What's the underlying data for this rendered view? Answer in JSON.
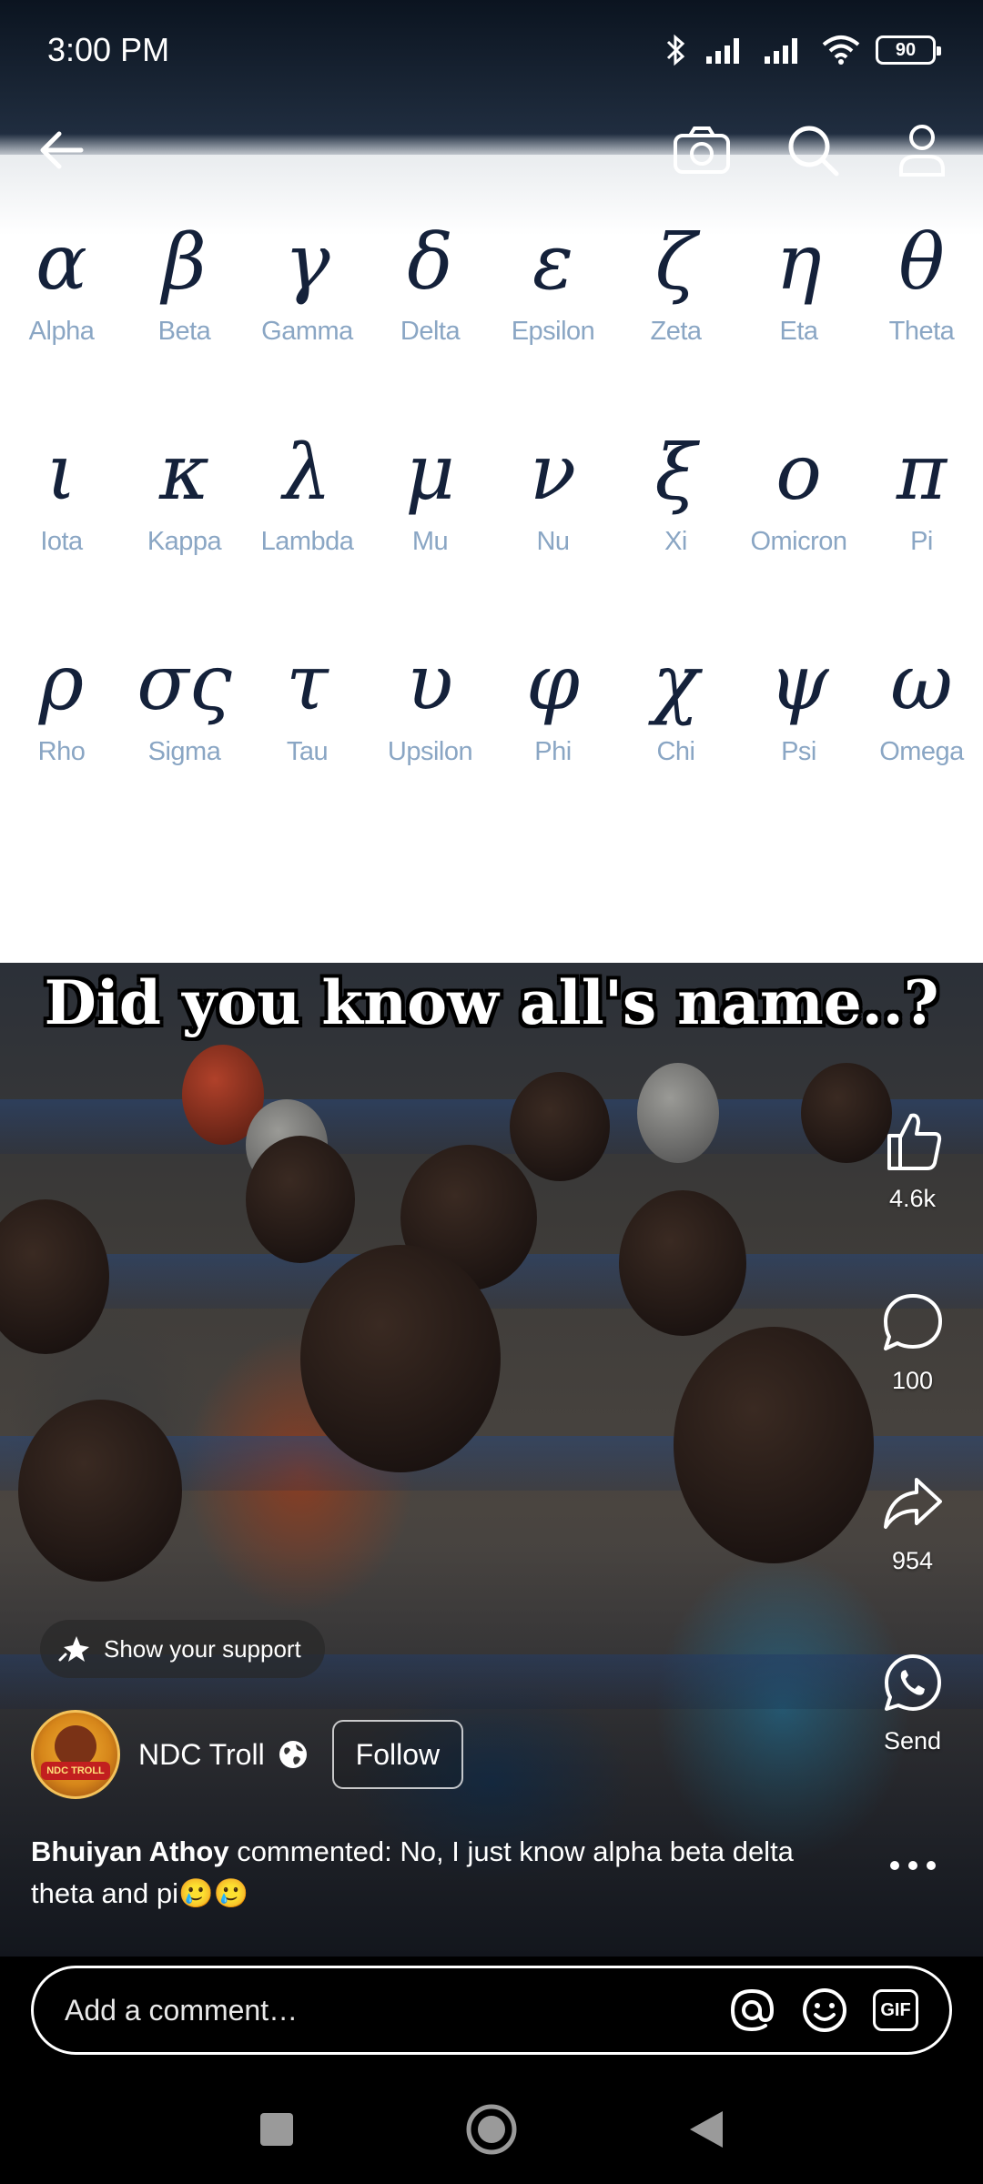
{
  "status_bar": {
    "time": "3:00 PM",
    "battery": "90"
  },
  "greek_letters": [
    {
      "symbol": "α",
      "name": "Alpha"
    },
    {
      "symbol": "β",
      "name": "Beta"
    },
    {
      "symbol": "γ",
      "name": "Gamma"
    },
    {
      "symbol": "δ",
      "name": "Delta"
    },
    {
      "symbol": "ε",
      "name": "Epsilon"
    },
    {
      "symbol": "ζ",
      "name": "Zeta"
    },
    {
      "symbol": "η",
      "name": "Eta"
    },
    {
      "symbol": "θ",
      "name": "Theta"
    },
    {
      "symbol": "ι",
      "name": "Iota"
    },
    {
      "symbol": "κ",
      "name": "Kappa"
    },
    {
      "symbol": "λ",
      "name": "Lambda"
    },
    {
      "symbol": "μ",
      "name": "Mu"
    },
    {
      "symbol": "ν",
      "name": "Nu"
    },
    {
      "symbol": "ξ",
      "name": "Xi"
    },
    {
      "symbol": "ο",
      "name": "Omicron"
    },
    {
      "symbol": "π",
      "name": "Pi"
    },
    {
      "symbol": "ρ",
      "name": "Rho"
    },
    {
      "symbol": "σς",
      "name": "Sigma"
    },
    {
      "symbol": "τ",
      "name": "Tau"
    },
    {
      "symbol": "υ",
      "name": "Upsilon"
    },
    {
      "symbol": "φ",
      "name": "Phi"
    },
    {
      "symbol": "χ",
      "name": "Chi"
    },
    {
      "symbol": "ψ",
      "name": "Psi"
    },
    {
      "symbol": "ω",
      "name": "Omega"
    }
  ],
  "caption": "Did you know all's name..?",
  "actions": {
    "likes": "4.6k",
    "comments": "100",
    "shares": "954",
    "send_label": "Send"
  },
  "support": {
    "label": "Show your support"
  },
  "author": {
    "name": "NDC Troll",
    "avatar_text": "NDC TROLL",
    "follow_label": "Follow"
  },
  "comment_preview": {
    "user": "Bhuiyan Athoy",
    "text": " commented: No, I just know alpha beta delta theta and pi🥲🥲"
  },
  "comment_bar": {
    "placeholder": "Add a comment…",
    "gif_label": "GIF"
  },
  "colors": {
    "background": "#000000",
    "greek_text": "#14213a",
    "greek_label": "#8aa6c4"
  }
}
